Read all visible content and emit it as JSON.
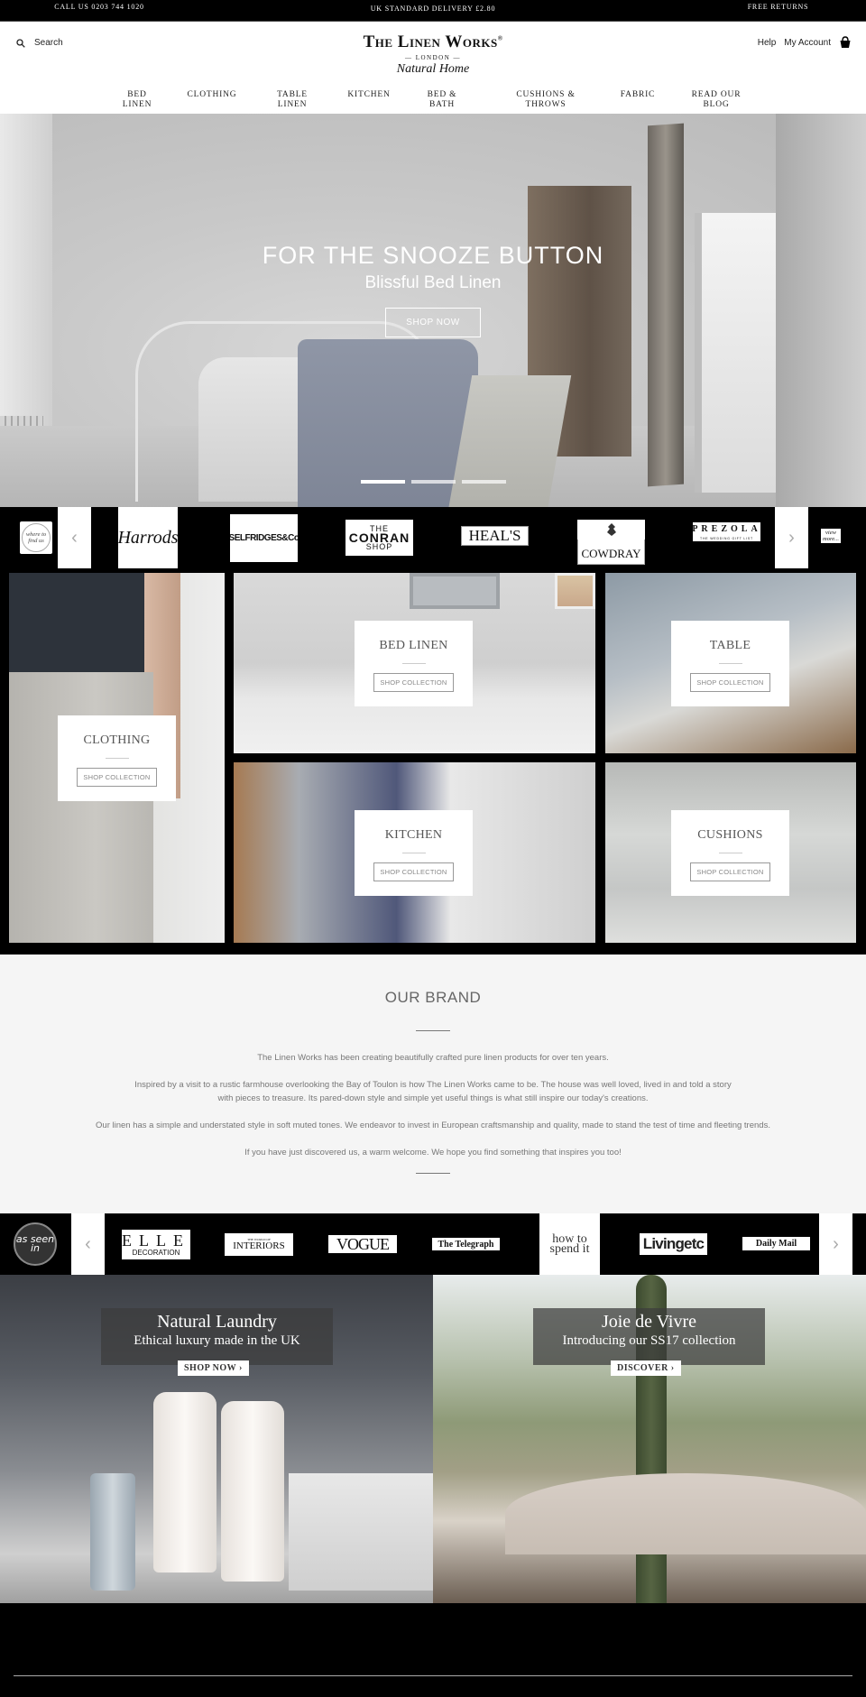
{
  "topbar": {
    "call": "CALL US 0203 744 1020",
    "delivery": "UK STANDARD DELIVERY £2.80",
    "returns": "FREE RETURNS"
  },
  "header": {
    "search_placeholder": "Search",
    "logo_main": "The Linen Works",
    "logo_reg": "®",
    "logo_london": "— LONDON —",
    "logo_tagline": "Natural Home",
    "help": "Help",
    "account": "My Account",
    "icons": {
      "search": "search-icon",
      "cart": "shopping-basket-icon"
    }
  },
  "nav": [
    {
      "label": "BED LINEN"
    },
    {
      "label": "CLOTHING"
    },
    {
      "label": "TABLE LINEN"
    },
    {
      "label": "KITCHEN"
    },
    {
      "label": "BED & BATH"
    },
    {
      "label": "CUSHIONS & THROWS"
    },
    {
      "label": "FABRIC"
    },
    {
      "label": "READ OUR BLOG"
    }
  ],
  "hero": {
    "title": "FOR THE SNOOZE BUTTON",
    "subtitle": "Blissful Bed Linen",
    "button": "SHOP NOW",
    "slides": 3,
    "active_slide": 1
  },
  "stockists": {
    "badge": "where to find us",
    "prev": "‹",
    "next": "›",
    "logos": [
      "Harrods",
      "SELFRIDGES&Co",
      "THE CONRAN SHOP",
      "HEAL'S",
      "COWDRAY",
      "PREZOLA"
    ],
    "conran": {
      "top": "THE",
      "mid": "CONRAN",
      "bot": "SHOP"
    },
    "prezola_sub": "THE WEDDING GIFT LIST",
    "view_more": "view more..."
  },
  "categories": [
    {
      "title": "CLOTHING",
      "button": "SHOP COLLECTION"
    },
    {
      "title": "BED LINEN",
      "button": "SHOP COLLECTION"
    },
    {
      "title": "TABLE",
      "button": "SHOP COLLECTION"
    },
    {
      "title": "KITCHEN",
      "button": "SHOP COLLECTION"
    },
    {
      "title": "CUSHIONS",
      "button": "SHOP COLLECTION"
    }
  ],
  "brand": {
    "heading": "OUR BRAND",
    "paragraphs": [
      "The Linen Works has been creating beautifully crafted pure linen products for over ten years.",
      "Inspired by a visit to a rustic farmhouse overlooking the Bay of Toulon is how The Linen Works came to be.  The house was well loved, lived in and told a story with pieces to treasure. Its pared-down style and simple yet useful things is what still inspire our today's creations.",
      "Our linen has a simple and understated style in soft muted tones. We endeavor to invest in European craftsmanship and quality, made to stand the test of time and fleeting trends.",
      "If you have just discovered us, a warm welcome. We hope you find something that inspires you too!"
    ]
  },
  "press": {
    "badge": "as seen in",
    "prev": "‹",
    "next": "›",
    "logos": [
      "ELLE DECORATION",
      "INTERIORS",
      "VOGUE",
      "The Telegraph",
      "how to spend it",
      "Livingetc",
      "Daily Mail"
    ],
    "elle_top": "ELLE",
    "elle_bot": "DECORATION",
    "interiors_top": "THE WORLD OF",
    "htsi_top": "how to",
    "htsi_bot": "spend it"
  },
  "promos": [
    {
      "title": "Natural Laundry",
      "subtitle": "Ethical luxury made in the UK",
      "button": "SHOP NOW ›"
    },
    {
      "title": "Joie de Vivre",
      "subtitle": "Introducing our SS17 collection",
      "button": "DISCOVER ›"
    }
  ],
  "colors": {
    "accent": "#000000",
    "text": "#333333",
    "brand_bg": "#f5f5f5"
  }
}
